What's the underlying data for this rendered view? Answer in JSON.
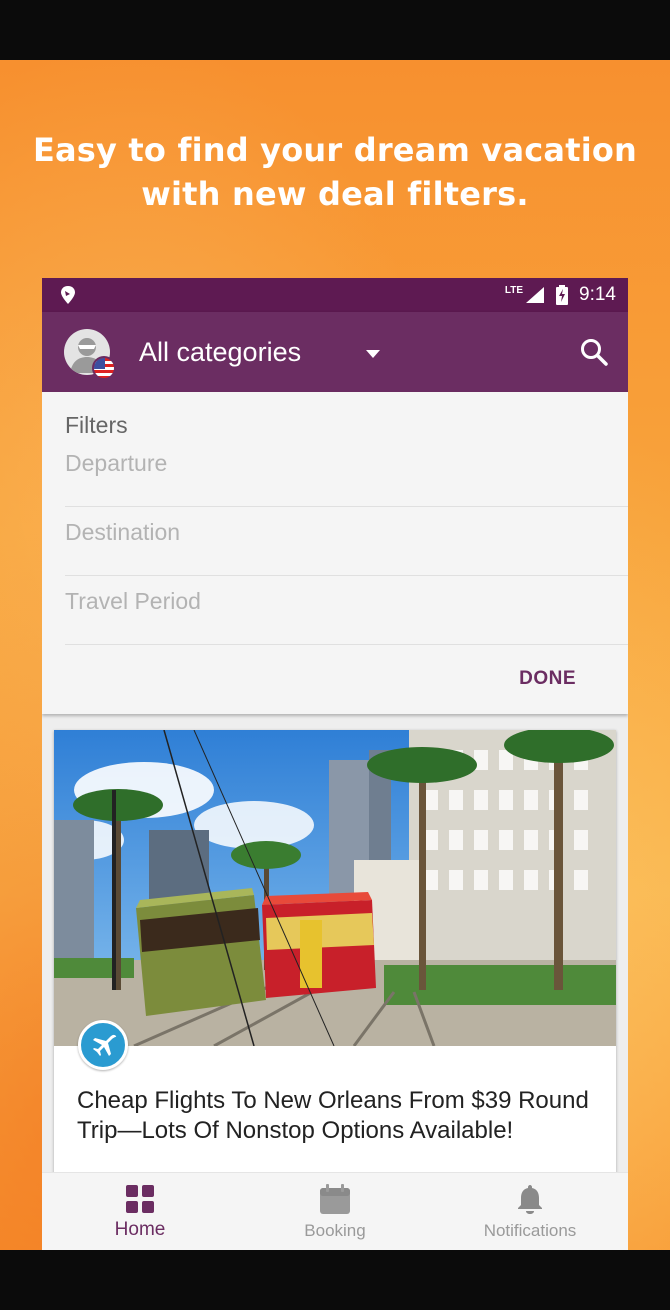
{
  "promo": {
    "headline_line1": "Easy to find your dream vacation",
    "headline_line2": "with new deal filters."
  },
  "status_bar": {
    "network": "LTE",
    "time": "9:14"
  },
  "app_bar": {
    "title": "All categories",
    "dropdown_icon": "caret-down-icon",
    "search_icon": "search-icon"
  },
  "filters": {
    "heading": "Filters",
    "fields": [
      {
        "placeholder": "Departure"
      },
      {
        "placeholder": "Destination"
      },
      {
        "placeholder": "Travel Period"
      }
    ],
    "done_label": "DONE"
  },
  "deal": {
    "category_icon": "airplane-icon",
    "title": "Cheap Flights To New Orleans From $39 Round Trip—Lots Of Nonstop Options Available!"
  },
  "bottom_nav": {
    "items": [
      {
        "label": "Home",
        "icon": "grid-icon",
        "active": true
      },
      {
        "label": "Booking",
        "icon": "calendar-icon",
        "active": false
      },
      {
        "label": "Notifications",
        "icon": "bell-icon",
        "active": false
      }
    ]
  },
  "colors": {
    "primary": "#6b2d62",
    "status_bar": "#5e1a52",
    "accent_badge": "#2a9bd1",
    "promo_background": "#f8a43c"
  }
}
